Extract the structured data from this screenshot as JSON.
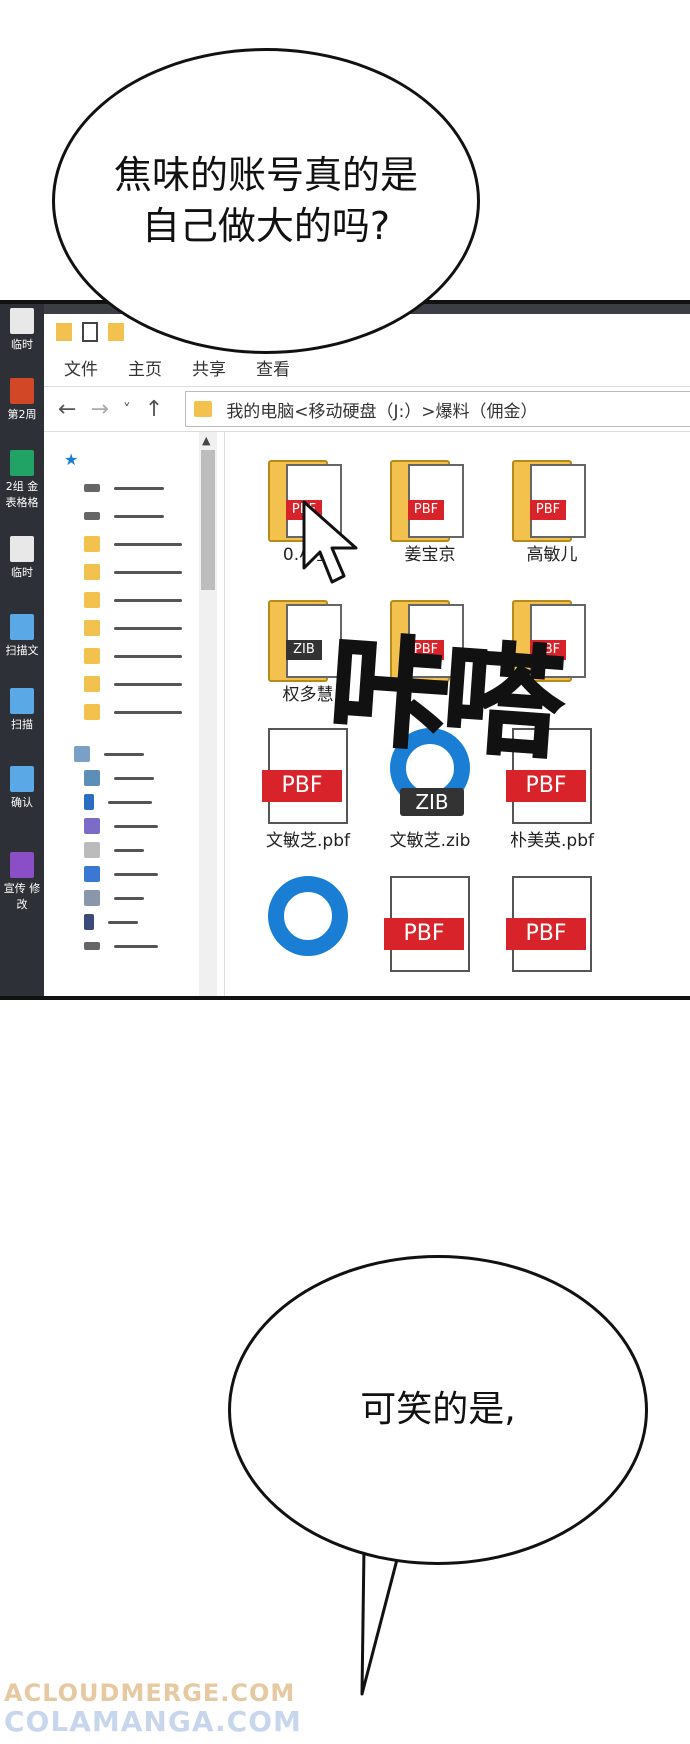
{
  "speech": {
    "bubble1_line1": "焦味的账号真的是",
    "bubble1_line2": "自己做大的吗?",
    "bubble2": "可笑的是,"
  },
  "sfx": "咔嗒",
  "desktop_icons": [
    {
      "label": "临时",
      "color": "#e8e8e8"
    },
    {
      "label": "第2周",
      "color": "#d24726"
    },
    {
      "label": "2组 金 表格格",
      "color": "#21a366"
    },
    {
      "label": "临时",
      "color": "#e8e8e8"
    },
    {
      "label": "扫描文",
      "color": "#5aa9e6"
    },
    {
      "label": "扫描",
      "color": "#5aa9e6"
    },
    {
      "label": "确认",
      "color": "#5aa9e6"
    },
    {
      "label": "宣传 修改",
      "color": "#8a4fc7"
    }
  ],
  "explorer": {
    "ribbon": [
      "文件",
      "主页",
      "共享",
      "查看"
    ],
    "address": "我的电脑<移动硬盘（J:）>爆料（佣金）",
    "nav": {
      "back": "←",
      "forward": "→",
      "dropdown": "˅",
      "up": "↑"
    },
    "files": [
      {
        "label": "0.小金",
        "kind": "folder-pbf"
      },
      {
        "label": "姜宝京",
        "kind": "folder-pbf"
      },
      {
        "label": "高敏儿",
        "kind": "folder-pbf"
      },
      {
        "label": "权多慧",
        "kind": "folder-zib"
      },
      {
        "label": "",
        "kind": "folder-pbf"
      },
      {
        "label": "",
        "kind": "folder-pbf"
      },
      {
        "label": "文敏芝.pbf",
        "kind": "pbf"
      },
      {
        "label": "文敏芝.zib",
        "kind": "zib"
      },
      {
        "label": "朴美英.pbf",
        "kind": "pbf"
      }
    ],
    "tag_pbf": "PBF",
    "tag_zib": "ZIB"
  },
  "watermark": {
    "line1": "ACLOUDMERGE.COM",
    "line2": "COLAMANGA.COM"
  }
}
